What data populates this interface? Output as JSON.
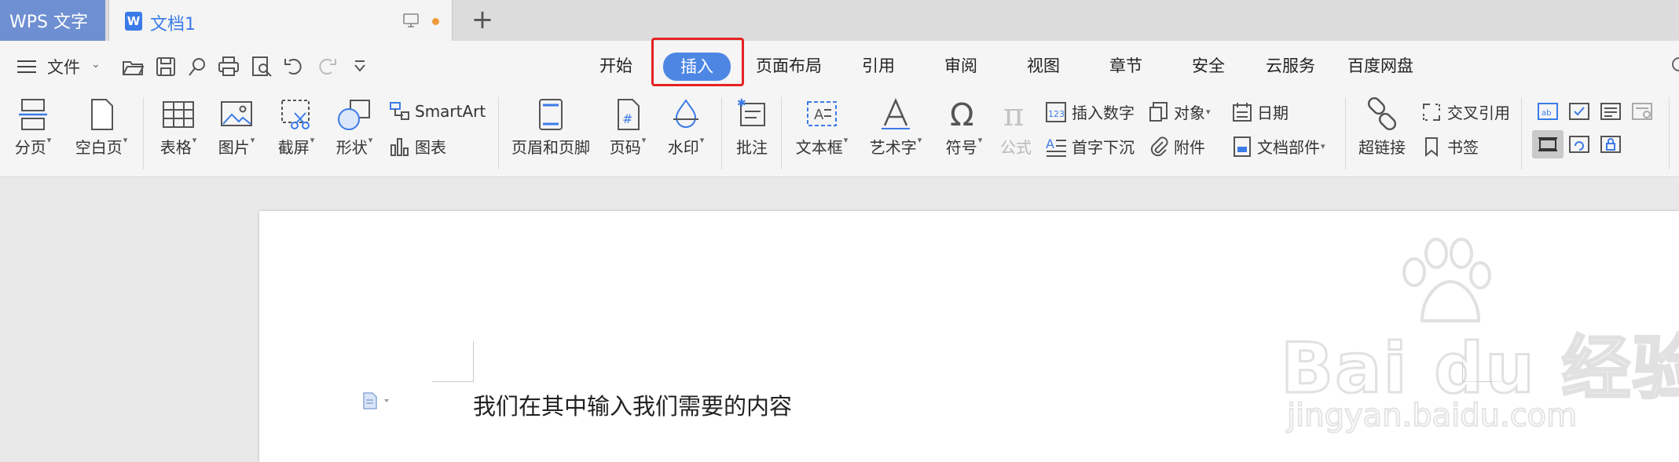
{
  "titlebar": {
    "app_name": "WPS 文字",
    "doc_tab_title": "文档1",
    "doc_icon_letter": "W",
    "new_tab_symbol": "+"
  },
  "menubar": {
    "file_label": "文件",
    "tabs": [
      "开始",
      "插入",
      "页面布局",
      "引用",
      "审阅",
      "视图",
      "章节",
      "安全",
      "云服务",
      "百度网盘"
    ],
    "active_tab": "插入",
    "accent_color": "#4e86e4",
    "highlight_color": "#e52222"
  },
  "ribbon": {
    "page_break": "分页",
    "blank_page": "空白页",
    "table": "表格",
    "picture": "图片",
    "screenshot": "截屏",
    "shape": "形状",
    "smartart": "SmartArt",
    "chart": "图表",
    "header_footer": "页眉和页脚",
    "page_number": "页码",
    "watermark": "水印",
    "comment": "批注",
    "text_box": "文本框",
    "wordart": "艺术字",
    "symbol": "符号",
    "formula": "公式",
    "insert_number": "插入数字",
    "drop_cap": "首字下沉",
    "object": "对象",
    "attachment": "附件",
    "date": "日期",
    "doc_parts": "文档部件",
    "hyperlink": "超链接",
    "cross_reference": "交叉引用",
    "bookmark": "书签"
  },
  "document": {
    "body_text": "我们在其中输入我们需要的内容"
  },
  "watermark": {
    "brand_text": "Bai du 经验",
    "url_text": "jingyan.baidu.com"
  }
}
